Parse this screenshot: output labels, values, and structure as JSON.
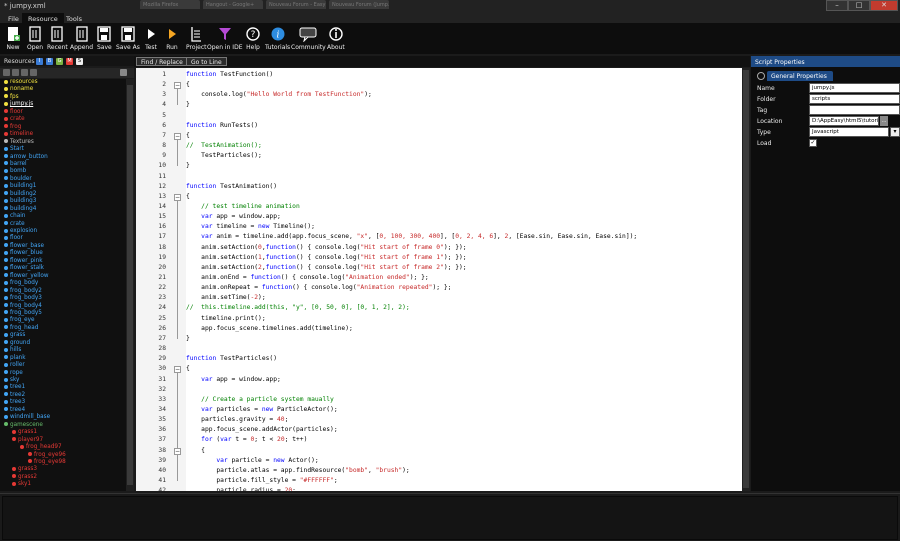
{
  "window": {
    "title": "* jumpy.xml",
    "background_tabs": [
      "Mozilla Firefox",
      "Hangout - Google+",
      "Nouveau Forum - Easy",
      "Nouveau Forum (Jump...)"
    ]
  },
  "menu": [
    "File",
    "Resource",
    "Tools"
  ],
  "toolbar": {
    "buttons": [
      {
        "label": "New",
        "icon": "new-file-icon"
      },
      {
        "label": "Open",
        "icon": "open-icon"
      },
      {
        "label": "Recent",
        "icon": "recent-icon"
      },
      {
        "label": "Append",
        "icon": "append-icon"
      },
      {
        "label": "Save",
        "icon": "save-icon"
      },
      {
        "label": "Save As",
        "icon": "save-as-icon"
      },
      {
        "label": "Test",
        "icon": "test-play-icon"
      },
      {
        "label": "Run",
        "icon": "run-play-icon"
      },
      {
        "label": "Project",
        "icon": "project-icon"
      },
      {
        "label": "Open in IDE",
        "icon": "ide-funnel-icon"
      },
      {
        "label": "Help",
        "icon": "help-icon"
      },
      {
        "label": "Tutorials",
        "icon": "info-icon"
      },
      {
        "label": "Community",
        "icon": "speech-bubble-icon"
      },
      {
        "label": "About",
        "icon": "about-info-icon"
      }
    ]
  },
  "resources": {
    "label": "Resources",
    "badges": [
      {
        "t": "I",
        "c": "#3a7bd5"
      },
      {
        "t": "B",
        "c": "#3a7bd5"
      },
      {
        "t": "G",
        "c": "#7cb342"
      },
      {
        "t": "M",
        "c": "#e53935"
      },
      {
        "t": "S",
        "c": "#eeeeee"
      }
    ],
    "tree": [
      {
        "t": "resources",
        "c": "#f0e040",
        "d": 1
      },
      {
        "t": "noname",
        "c": "#f0e040",
        "d": 1
      },
      {
        "t": "fps",
        "c": "#f0e040",
        "d": 1
      },
      {
        "t": "jumpy.js",
        "c": "#f0e040",
        "d": 1,
        "sel": true
      },
      {
        "t": "floor",
        "c": "#e53935",
        "d": 1
      },
      {
        "t": "crate",
        "c": "#e53935",
        "d": 1
      },
      {
        "t": "frog",
        "c": "#e53935",
        "d": 1
      },
      {
        "t": "timeline",
        "c": "#e53935",
        "d": 1
      },
      {
        "t": "Textures",
        "c": "#bbbbbb",
        "d": 1
      },
      {
        "t": "Start",
        "c": "#42a5f5",
        "d": 1
      },
      {
        "t": "arrow_button",
        "c": "#42a5f5",
        "d": 1
      },
      {
        "t": "barrel",
        "c": "#42a5f5",
        "d": 1
      },
      {
        "t": "bomb",
        "c": "#42a5f5",
        "d": 1
      },
      {
        "t": "boulder",
        "c": "#42a5f5",
        "d": 1
      },
      {
        "t": "building1",
        "c": "#42a5f5",
        "d": 1
      },
      {
        "t": "building2",
        "c": "#42a5f5",
        "d": 1
      },
      {
        "t": "building3",
        "c": "#42a5f5",
        "d": 1
      },
      {
        "t": "building4",
        "c": "#42a5f5",
        "d": 1
      },
      {
        "t": "chain",
        "c": "#42a5f5",
        "d": 1
      },
      {
        "t": "crate",
        "c": "#42a5f5",
        "d": 1
      },
      {
        "t": "explosion",
        "c": "#42a5f5",
        "d": 1
      },
      {
        "t": "floor",
        "c": "#42a5f5",
        "d": 1
      },
      {
        "t": "flower_base",
        "c": "#42a5f5",
        "d": 1
      },
      {
        "t": "flower_blue",
        "c": "#42a5f5",
        "d": 1
      },
      {
        "t": "flower_pink",
        "c": "#42a5f5",
        "d": 1
      },
      {
        "t": "flower_stalk",
        "c": "#42a5f5",
        "d": 1
      },
      {
        "t": "flower_yellow",
        "c": "#42a5f5",
        "d": 1
      },
      {
        "t": "frog_body",
        "c": "#42a5f5",
        "d": 1
      },
      {
        "t": "frog_body2",
        "c": "#42a5f5",
        "d": 1
      },
      {
        "t": "frog_body3",
        "c": "#42a5f5",
        "d": 1
      },
      {
        "t": "frog_body4",
        "c": "#42a5f5",
        "d": 1
      },
      {
        "t": "frog_body5",
        "c": "#42a5f5",
        "d": 1
      },
      {
        "t": "frog_eye",
        "c": "#42a5f5",
        "d": 1
      },
      {
        "t": "frog_head",
        "c": "#42a5f5",
        "d": 1
      },
      {
        "t": "grass",
        "c": "#42a5f5",
        "d": 1
      },
      {
        "t": "ground",
        "c": "#42a5f5",
        "d": 1
      },
      {
        "t": "hills",
        "c": "#42a5f5",
        "d": 1
      },
      {
        "t": "plank",
        "c": "#42a5f5",
        "d": 1
      },
      {
        "t": "roller",
        "c": "#42a5f5",
        "d": 1
      },
      {
        "t": "rope",
        "c": "#42a5f5",
        "d": 1
      },
      {
        "t": "sky",
        "c": "#42a5f5",
        "d": 1
      },
      {
        "t": "tree1",
        "c": "#42a5f5",
        "d": 1
      },
      {
        "t": "tree2",
        "c": "#42a5f5",
        "d": 1
      },
      {
        "t": "tree3",
        "c": "#42a5f5",
        "d": 1
      },
      {
        "t": "tree4",
        "c": "#42a5f5",
        "d": 1
      },
      {
        "t": "windmill_base",
        "c": "#42a5f5",
        "d": 1
      },
      {
        "t": "gamescene",
        "c": "#66bb6a",
        "d": 1
      },
      {
        "t": "grass1",
        "c": "#e53935",
        "d": 2
      },
      {
        "t": "player97",
        "c": "#e53935",
        "d": 2
      },
      {
        "t": "frog_head97",
        "c": "#e53935",
        "d": 3
      },
      {
        "t": "frog_eye96",
        "c": "#e53935",
        "d": 4
      },
      {
        "t": "frog_eye98",
        "c": "#e53935",
        "d": 4
      },
      {
        "t": "grass3",
        "c": "#e53935",
        "d": 2
      },
      {
        "t": "grass2",
        "c": "#e53935",
        "d": 2
      },
      {
        "t": "sky1",
        "c": "#e53935",
        "d": 2
      }
    ]
  },
  "editor": {
    "find_label": "Find / Replace",
    "goto_label": "Go to Line",
    "folds": [
      2,
      7,
      13,
      30,
      38
    ],
    "lines": [
      [
        [
          "kw",
          "function "
        ],
        [
          "p",
          "TestFunction()"
        ]
      ],
      [
        [
          "p",
          "{"
        ]
      ],
      [
        [
          "p",
          "    console.log("
        ],
        [
          "str",
          "\"Hello World from TestFunction\""
        ],
        [
          "p",
          ");"
        ]
      ],
      [
        [
          "p",
          "}"
        ]
      ],
      [
        [
          "p",
          ""
        ]
      ],
      [
        [
          "kw",
          "function "
        ],
        [
          "p",
          "RunTests()"
        ]
      ],
      [
        [
          "p",
          "{"
        ]
      ],
      [
        [
          "cm",
          "//  TestAnimation();"
        ]
      ],
      [
        [
          "p",
          "    TestParticles();"
        ]
      ],
      [
        [
          "p",
          "}"
        ]
      ],
      [
        [
          "p",
          ""
        ]
      ],
      [
        [
          "kw",
          "function "
        ],
        [
          "p",
          "TestAnimation()"
        ]
      ],
      [
        [
          "p",
          "{"
        ]
      ],
      [
        [
          "cm",
          "    // test timeline animation"
        ]
      ],
      [
        [
          "p",
          "    "
        ],
        [
          "kw",
          "var "
        ],
        [
          "p",
          "app = window.app;"
        ]
      ],
      [
        [
          "p",
          "    "
        ],
        [
          "kw",
          "var "
        ],
        [
          "p",
          "timeline = "
        ],
        [
          "kw",
          "new "
        ],
        [
          "p",
          "Timeline();"
        ]
      ],
      [
        [
          "p",
          "    "
        ],
        [
          "kw",
          "var "
        ],
        [
          "p",
          "anim = timeline.add(app.focus_scene, "
        ],
        [
          "str",
          "\"x\""
        ],
        [
          "p",
          ", ["
        ],
        [
          "num",
          "0, 100, 300, 400"
        ],
        [
          "p",
          "], ["
        ],
        [
          "num",
          "0, 2, 4, 6"
        ],
        [
          "p",
          "], "
        ],
        [
          "num",
          "2"
        ],
        [
          "p",
          ", [Ease.sin, Ease.sin, Ease.sin]);"
        ]
      ],
      [
        [
          "p",
          "    anim.setAction("
        ],
        [
          "num",
          "0"
        ],
        [
          "p",
          ","
        ],
        [
          "kw",
          "function"
        ],
        [
          "p",
          "() { console.log("
        ],
        [
          "str",
          "\"Hit start of frame 0\""
        ],
        [
          "p",
          "); });"
        ]
      ],
      [
        [
          "p",
          "    anim.setAction("
        ],
        [
          "num",
          "1"
        ],
        [
          "p",
          ","
        ],
        [
          "kw",
          "function"
        ],
        [
          "p",
          "() { console.log("
        ],
        [
          "str",
          "\"Hit start of frame 1\""
        ],
        [
          "p",
          "); });"
        ]
      ],
      [
        [
          "p",
          "    anim.setAction("
        ],
        [
          "num",
          "2"
        ],
        [
          "p",
          ","
        ],
        [
          "kw",
          "function"
        ],
        [
          "p",
          "() { console.log("
        ],
        [
          "str",
          "\"Hit start of frame 2\""
        ],
        [
          "p",
          "); });"
        ]
      ],
      [
        [
          "p",
          "    anim.onEnd = "
        ],
        [
          "kw",
          "function"
        ],
        [
          "p",
          "() { console.log("
        ],
        [
          "str",
          "\"Animation ended\""
        ],
        [
          "p",
          "); };"
        ]
      ],
      [
        [
          "p",
          "    anim.onRepeat = "
        ],
        [
          "kw",
          "function"
        ],
        [
          "p",
          "() { console.log("
        ],
        [
          "str",
          "\"Animation repeated\""
        ],
        [
          "p",
          "); };"
        ]
      ],
      [
        [
          "p",
          "    anim.setTime("
        ],
        [
          "num",
          "-2"
        ],
        [
          "p",
          ");"
        ]
      ],
      [
        [
          "cm",
          "//  this.timeline.add(this, \"y\", [0, 50, 0], [0, 1, 2], 2);"
        ]
      ],
      [
        [
          "p",
          "    timeline.print();"
        ]
      ],
      [
        [
          "p",
          "    app.focus_scene.timelines.add(timeline);"
        ]
      ],
      [
        [
          "p",
          "}"
        ]
      ],
      [
        [
          "p",
          ""
        ]
      ],
      [
        [
          "kw",
          "function "
        ],
        [
          "p",
          "TestParticles()"
        ]
      ],
      [
        [
          "p",
          "{"
        ]
      ],
      [
        [
          "p",
          "    "
        ],
        [
          "kw",
          "var "
        ],
        [
          "p",
          "app = window.app;"
        ]
      ],
      [
        [
          "p",
          ""
        ]
      ],
      [
        [
          "cm",
          "    // Create a particle system maually"
        ]
      ],
      [
        [
          "p",
          "    "
        ],
        [
          "kw",
          "var "
        ],
        [
          "p",
          "particles = "
        ],
        [
          "kw",
          "new "
        ],
        [
          "p",
          "ParticleActor();"
        ]
      ],
      [
        [
          "p",
          "    particles.gravity = "
        ],
        [
          "num",
          "40"
        ],
        [
          "p",
          ";"
        ]
      ],
      [
        [
          "p",
          "    app.focus_scene.addActor(particles);"
        ]
      ],
      [
        [
          "p",
          "    "
        ],
        [
          "kw",
          "for "
        ],
        [
          "p",
          "("
        ],
        [
          "kw",
          "var "
        ],
        [
          "p",
          "t = "
        ],
        [
          "num",
          "0"
        ],
        [
          "p",
          "; t < "
        ],
        [
          "num",
          "20"
        ],
        [
          "p",
          "; t++)"
        ]
      ],
      [
        [
          "p",
          "    {"
        ]
      ],
      [
        [
          "p",
          "        "
        ],
        [
          "kw",
          "var "
        ],
        [
          "p",
          "particle = "
        ],
        [
          "kw",
          "new "
        ],
        [
          "p",
          "Actor();"
        ]
      ],
      [
        [
          "p",
          "        particle.atlas = app.findResource("
        ],
        [
          "str",
          "\"bomb\""
        ],
        [
          "p",
          ", "
        ],
        [
          "str",
          "\"brush\""
        ],
        [
          "p",
          ");"
        ]
      ],
      [
        [
          "p",
          "        particle.fill_style = "
        ],
        [
          "str",
          "\"#FFFFFF\""
        ],
        [
          "p",
          ";"
        ]
      ],
      [
        [
          "p",
          "        particle.radius = "
        ],
        [
          "num",
          "20"
        ],
        [
          "p",
          ";"
        ]
      ]
    ]
  },
  "properties": {
    "title": "Script Properties",
    "section": "General Properties",
    "name_label": "Name",
    "name_value": "jumpy.js",
    "folder_label": "Folder",
    "folder_value": "scripts",
    "tag_label": "Tag",
    "tag_value": "",
    "location_label": "Location",
    "location_value": "D:\\AppEasy\\html5\\tutori",
    "browse_label": "...",
    "type_label": "Type",
    "type_value": "Javascript",
    "load_label": "Load",
    "load_value": "✓"
  }
}
